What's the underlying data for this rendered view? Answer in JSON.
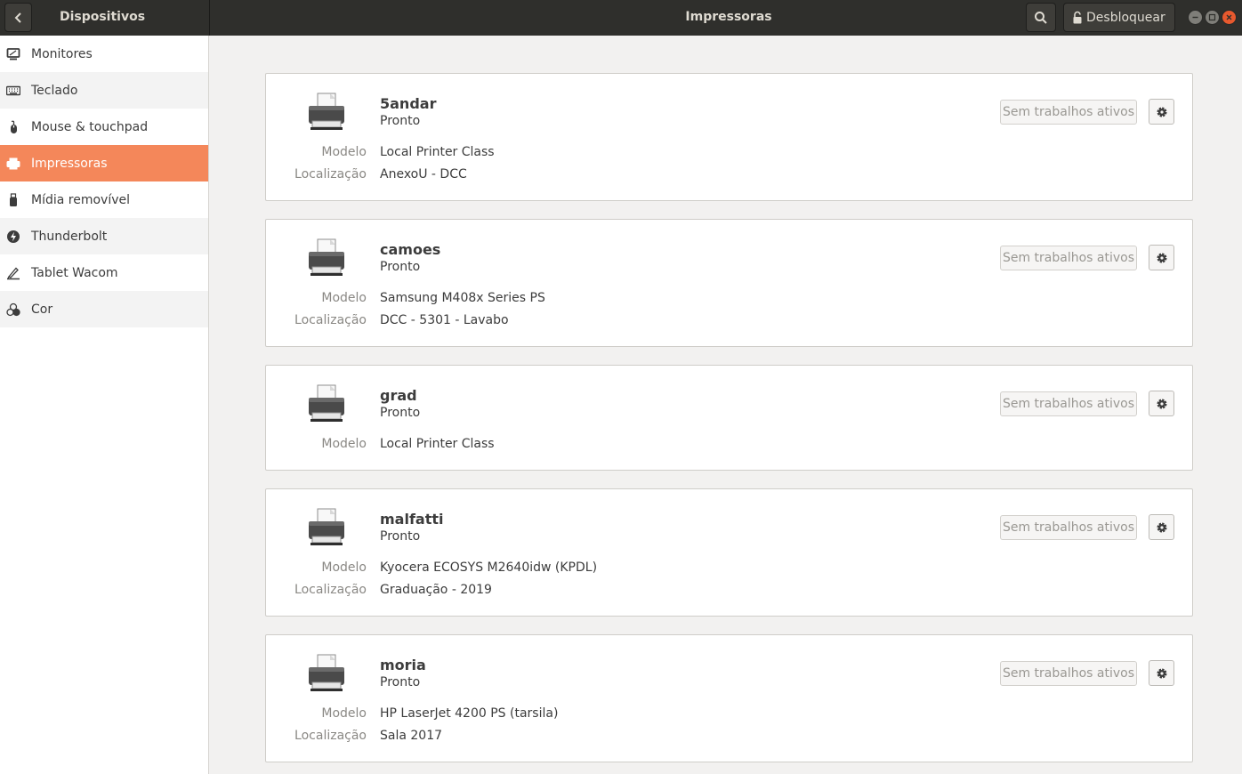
{
  "header": {
    "back_icon": "chevron-left-icon",
    "sidebar_title": "Dispositivos",
    "main_title": "Impressoras",
    "search_icon": "search-icon",
    "unlock_label": "Desbloquear",
    "unlock_icon": "lock-icon"
  },
  "sidebar": {
    "items": [
      {
        "label": "Monitores",
        "icon": "monitor-icon"
      },
      {
        "label": "Teclado",
        "icon": "keyboard-icon"
      },
      {
        "label": "Mouse & touchpad",
        "icon": "mouse-icon"
      },
      {
        "label": "Impressoras",
        "icon": "printer-icon",
        "active": true
      },
      {
        "label": "Mídia removível",
        "icon": "usb-icon"
      },
      {
        "label": "Thunderbolt",
        "icon": "thunderbolt-icon"
      },
      {
        "label": "Tablet Wacom",
        "icon": "tablet-icon"
      },
      {
        "label": "Cor",
        "icon": "color-icon"
      }
    ]
  },
  "labels": {
    "model": "Modelo",
    "location": "Localização",
    "jobs": "Sem trabalhos ativos"
  },
  "printers": [
    {
      "name": "5andar",
      "status": "Pronto",
      "model": "Local Printer Class",
      "location": "AnexoU - DCC"
    },
    {
      "name": "camoes",
      "status": "Pronto",
      "model": "Samsung M408x Series PS",
      "location": "DCC - 5301 - Lavabo"
    },
    {
      "name": "grad",
      "status": "Pronto",
      "model": "Local Printer Class",
      "location": ""
    },
    {
      "name": "malfatti",
      "status": "Pronto",
      "model": "Kyocera ECOSYS M2640idw (KPDL)",
      "location": "Graduação - 2019"
    },
    {
      "name": "moria",
      "status": "Pronto",
      "model": "HP LaserJet 4200 PS (tarsila)",
      "location": "Sala 2017"
    }
  ],
  "colors": {
    "accent": "#f4875a",
    "headerbar": "#2f2f2c",
    "close_button": "#e8592e"
  }
}
